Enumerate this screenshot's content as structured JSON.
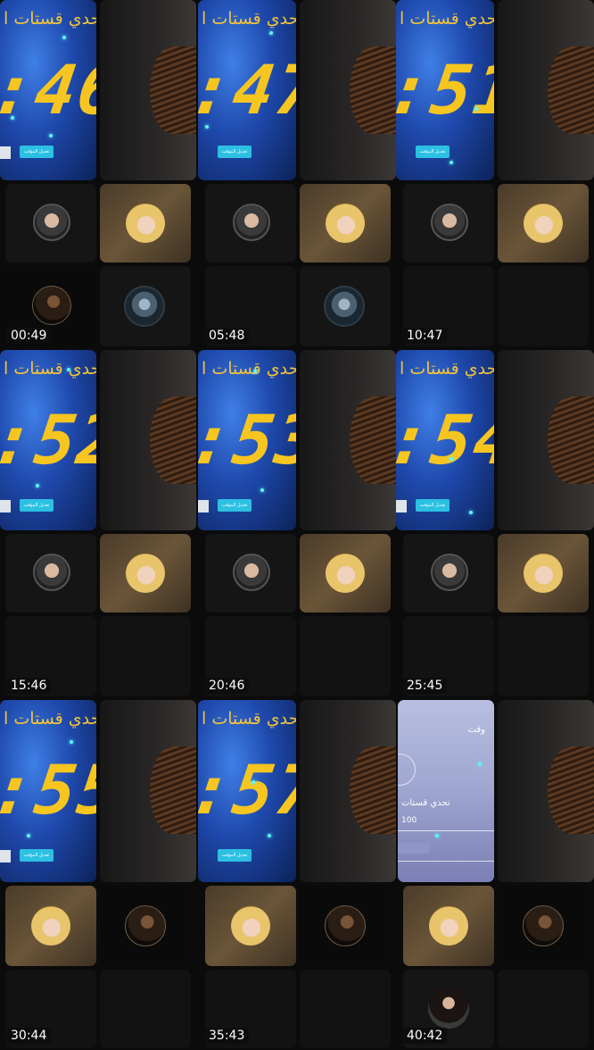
{
  "thumbnails": [
    {
      "time": "00:49",
      "title": "تحدي قستات ا",
      "digits": ":46",
      "edit_label": "تعديل المؤقت",
      "variant": "timer"
    },
    {
      "time": "05:48",
      "title": "تحدي قستات ا",
      "digits": ":47",
      "edit_label": "تعديل المؤقت",
      "variant": "timer"
    },
    {
      "time": "10:47",
      "title": "تحدي قستات ا",
      "digits": ":51",
      "edit_label": "تعديل المؤقت",
      "variant": "timer"
    },
    {
      "time": "15:46",
      "title": "تحدي قستات ا",
      "digits": ":52",
      "edit_label": "تعديل المؤقت",
      "variant": "timer"
    },
    {
      "time": "20:46",
      "title": "تحدي قستات ا",
      "digits": ":53",
      "edit_label": "تعديل المؤقت",
      "variant": "timer"
    },
    {
      "time": "25:45",
      "title": "تحدي قستات ا",
      "digits": ":54",
      "edit_label": "تعديل المؤقت",
      "variant": "timer"
    },
    {
      "time": "30:44",
      "title": "تحدي قستات ا",
      "digits": ":55",
      "edit_label": "تعديل المؤقت",
      "variant": "timer"
    },
    {
      "time": "35:43",
      "title": "تحدي قستات ا",
      "digits": ":57",
      "edit_label": "تعديل المؤقت",
      "variant": "timer"
    },
    {
      "time": "40:42",
      "lav_title": "وقت",
      "lav_sub": "تحدي قستات",
      "lav_num": "100",
      "variant": "lavender"
    }
  ],
  "colors": {
    "timer_digits": "#f6c520",
    "edit_button": "#2cc0e2",
    "background": "#000000"
  }
}
